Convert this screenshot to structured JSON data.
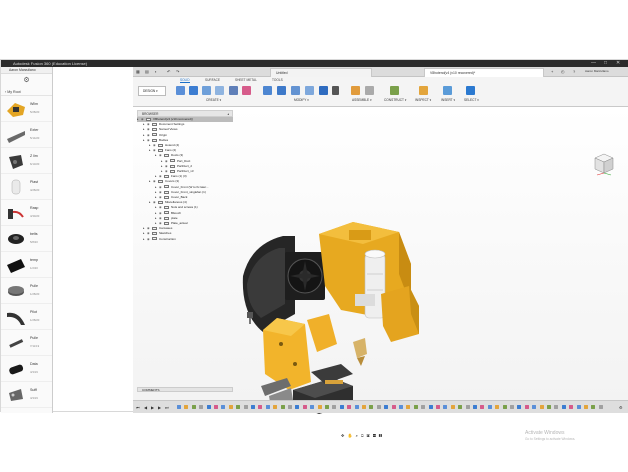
{
  "window": {
    "title": "Autodesk Fusion 360 (Education License)",
    "controls": [
      "—",
      "□",
      "✕"
    ]
  },
  "data_panel": {
    "user": "Aaron Marzullano",
    "settings_icon": "gear-icon",
    "project": "My Root",
    "items": [
      {
        "name": "Wllm",
        "date": "5/28/20",
        "thumb": "yellow-part"
      },
      {
        "name": "Exter",
        "date": "5/14/20",
        "thumb": "gray-bracket"
      },
      {
        "name": "Z lim",
        "date": "6/13/20",
        "thumb": "dark-plate"
      },
      {
        "name": "Plast",
        "date": "4/28/20",
        "thumb": "white-part"
      },
      {
        "name": "Rasp",
        "date": "4/30/20",
        "thumb": "red-cable"
      },
      {
        "name": "belts",
        "date": "5/8/20",
        "thumb": "black-gear"
      },
      {
        "name": "temp",
        "date": "1/2/20",
        "thumb": "black-plate"
      },
      {
        "name": "Pulle",
        "date": "1/28/20",
        "thumb": "gray-pulley"
      },
      {
        "name": "Pilot",
        "date": "1/28/20",
        "thumb": "arc-part"
      },
      {
        "name": "Pulle",
        "date": "7/11/19",
        "thumb": "probe"
      },
      {
        "name": "Data",
        "date": "4/3/19",
        "thumb": "cylinder"
      },
      {
        "name": "Suffi",
        "date": "4/3/19",
        "thumb": "bracket"
      }
    ]
  },
  "tabs": [
    {
      "label": "Untitled"
    },
    {
      "label": "V8hotend(v4 (v10 recovered)*"
    }
  ],
  "ribbon": {
    "tabs": [
      "SOLID",
      "SURFACE",
      "SHEET METAL",
      "TOOLS"
    ],
    "active_tab": "SOLID",
    "workspace": "DESIGN ▾",
    "groups": [
      "CREATE ▾",
      "MODIFY ▾",
      "ASSEMBLE ▾",
      "CONSTRUCT ▾",
      "INSPECT ▾",
      "INSERT ▾",
      "SELECT ▾"
    ]
  },
  "browser": {
    "title": "BROWSER",
    "rows": [
      {
        "label": "V8hotend(v4 (v10 recovered))",
        "level": 0,
        "root": true
      },
      {
        "label": "Document Settings",
        "level": 1
      },
      {
        "label": "Named Views",
        "level": 1
      },
      {
        "label": "Origin",
        "level": 1
      },
      {
        "label": "Bodies",
        "level": 1
      },
      {
        "label": "Hotend (4)",
        "level": 2
      },
      {
        "label": "Fans (2)",
        "level": 2
      },
      {
        "label": "Ducts (3)",
        "level": 3
      },
      {
        "label": "Part_Duct",
        "level": 4
      },
      {
        "label": "PartDuct_2",
        "level": 4
      },
      {
        "label": "PartDuct_v3",
        "level": 4
      },
      {
        "label": "Fans (1) (3)",
        "level": 3
      },
      {
        "label": "Covers (3)",
        "level": 2
      },
      {
        "label": "Cover_Front (W to fix later...",
        "level": 3
      },
      {
        "label": "Cover_Front_singlefan (1)",
        "level": 3
      },
      {
        "label": "Cover_Back",
        "level": 3
      },
      {
        "label": "Miscellanous (4)",
        "level": 2
      },
      {
        "label": "Nuts and screws (1)",
        "level": 3
      },
      {
        "label": "Bltouch",
        "level": 3
      },
      {
        "label": "plate",
        "level": 3
      },
      {
        "label": "Plate_actual",
        "level": 3
      },
      {
        "label": "Canvases",
        "level": 1
      },
      {
        "label": "Sketches",
        "level": 1
      },
      {
        "label": "Construction",
        "level": 1
      }
    ]
  },
  "comments": {
    "title": "COMMENTS"
  },
  "watermark": {
    "title": "Activate Windows",
    "subtitle": "Go to Settings to activate Windows."
  },
  "colors": {
    "yellow_part": "#f0b428",
    "dark_part": "#262626",
    "white_part": "#ececec",
    "accent": "#1a6fc9"
  }
}
